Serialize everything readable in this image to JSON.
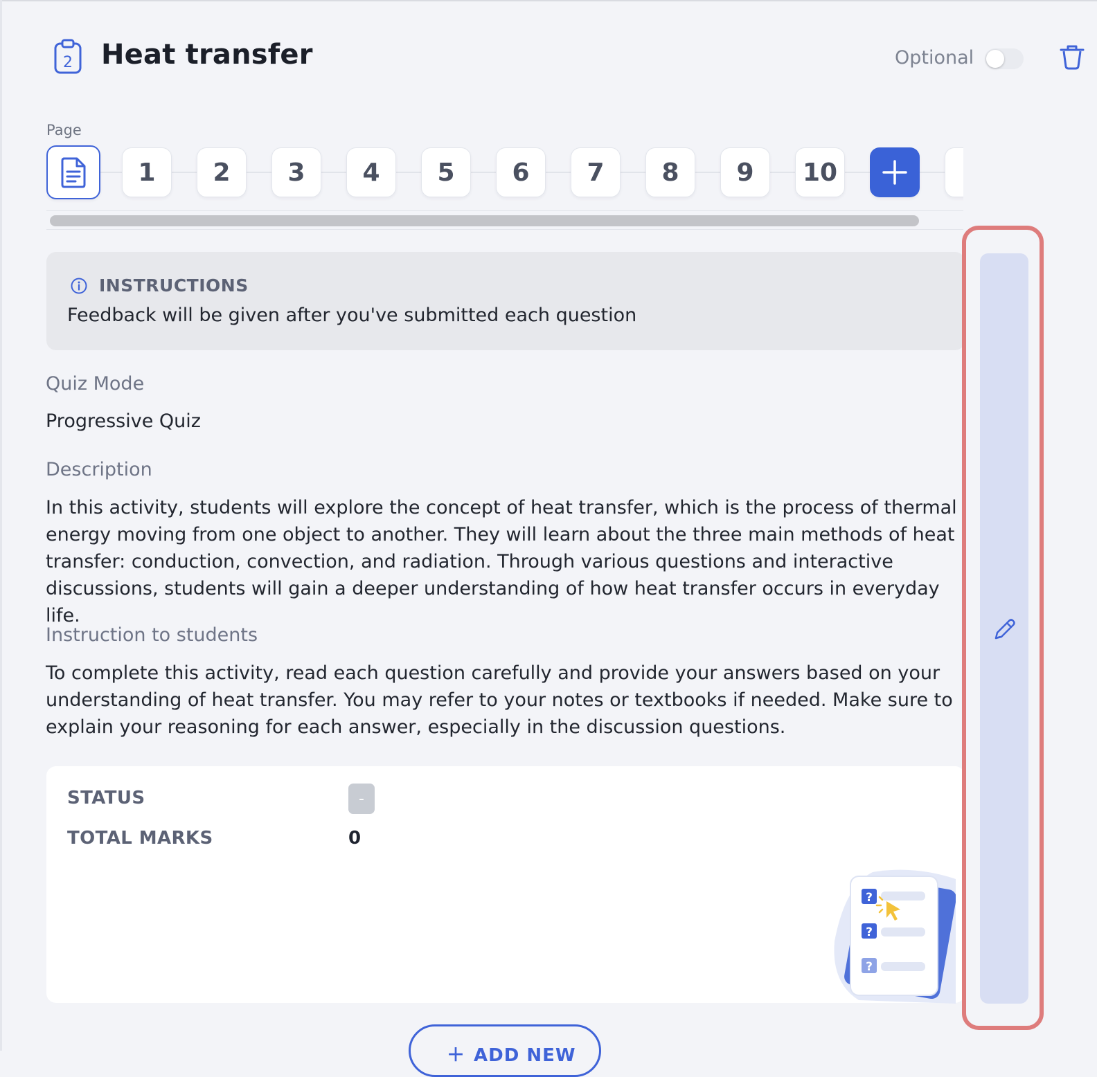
{
  "header": {
    "title": "Heat transfer",
    "icon_number": "2",
    "optional_label": "Optional",
    "optional_enabled": false
  },
  "pages": {
    "label": "Page",
    "items": [
      "1",
      "2",
      "3",
      "4",
      "5",
      "6",
      "7",
      "8",
      "9",
      "10"
    ],
    "add_icon": "plus-icon",
    "first_icon": "document-icon"
  },
  "instructions": {
    "title": "INSTRUCTIONS",
    "text": "Feedback will be given after you've submitted each question"
  },
  "quiz_mode": {
    "label": "Quiz Mode",
    "value": "Progressive Quiz"
  },
  "description": {
    "label": "Description",
    "text": "In this activity, students will explore the concept of heat transfer, which is the process of thermal energy moving from one object to another. They will learn about the three main methods of heat transfer: conduction, convection, and radiation. Through various questions and interactive discussions, students will gain a deeper understanding of how heat transfer occurs in everyday life."
  },
  "student_instruction": {
    "label": "Instruction to students",
    "text": "To complete this activity, read each question carefully and provide your answers based on your understanding of heat transfer. You may refer to your notes or textbooks if needed. Make sure to explain your reasoning for each answer, especially in the discussion questions."
  },
  "status": {
    "status_label": "STATUS",
    "status_value": "-",
    "marks_label": "TOTAL MARKS",
    "marks_value": "0"
  },
  "actions": {
    "add_new": "ADD NEW"
  },
  "colors": {
    "accent": "#3a62d7",
    "highlight": "#de7c7c",
    "edit_panel": "#d8def3"
  }
}
